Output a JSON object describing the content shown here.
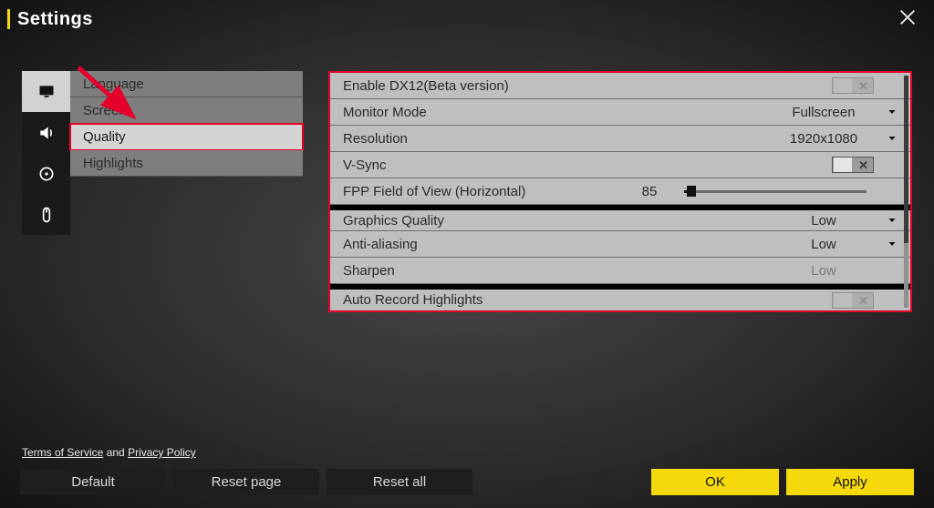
{
  "title": "Settings",
  "tabs": [
    "Display",
    "Audio",
    "Controls",
    "Mouse"
  ],
  "submenu": {
    "items": [
      "Language",
      "Screen",
      "Quality",
      "Highlights"
    ],
    "selected": 2
  },
  "rows": {
    "dx12": {
      "label": "Enable DX12(Beta version)"
    },
    "monmode": {
      "label": "Monitor Mode",
      "value": "Fullscreen"
    },
    "res": {
      "label": "Resolution",
      "value": "1920x1080"
    },
    "vsync": {
      "label": "V-Sync"
    },
    "fov": {
      "label": "FPP Field of View (Horizontal)",
      "value": "85"
    },
    "gfx": {
      "label": "Graphics Quality",
      "value": "Low"
    },
    "aa": {
      "label": "Anti-aliasing",
      "value": "Low"
    },
    "sharpen": {
      "label": "Sharpen",
      "value": "Low"
    },
    "autorec": {
      "label": "Auto Record Highlights"
    }
  },
  "footer": {
    "default": "Default",
    "resetpage": "Reset page",
    "resetall": "Reset all",
    "ok": "OK",
    "apply": "Apply"
  },
  "legal": {
    "tos": "Terms of Service",
    "and": " and ",
    "pp": "Privacy Policy"
  }
}
